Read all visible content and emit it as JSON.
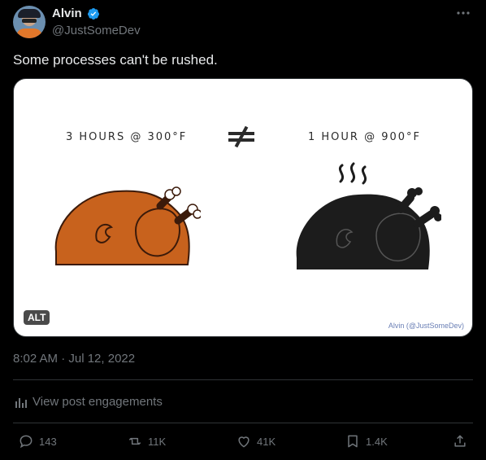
{
  "author": {
    "name": "Alvin",
    "handle": "@JustSomeDev",
    "verified": true
  },
  "post": {
    "text": "Some processes can't be rushed.",
    "timestamp": "8:02 AM · Jul 12, 2022"
  },
  "media": {
    "left_label": "3 HOURS @ 300°F",
    "right_label": "1 HOUR @ 900°F",
    "alt_badge": "ALT",
    "credit": "Alvin (@JustSomeDev)",
    "colors": {
      "roasted": "#c8621d",
      "burnt": "#1c1c1c"
    }
  },
  "engagements": {
    "label": "View post engagements"
  },
  "actions": {
    "replies": "143",
    "reposts": "11K",
    "likes": "41K",
    "bookmarks": "1.4K"
  },
  "icons": [
    "more-icon",
    "verified-badge-icon",
    "not-equal-icon",
    "chart-icon",
    "reply-icon",
    "repost-icon",
    "like-icon",
    "bookmark-icon",
    "share-icon"
  ]
}
